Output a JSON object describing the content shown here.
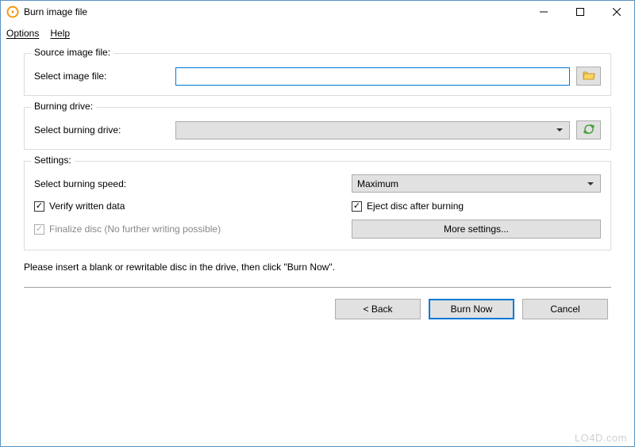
{
  "window": {
    "title": "Burn image file"
  },
  "menu": {
    "options": "Options",
    "help": "Help"
  },
  "group_source": {
    "legend": "Source image file:",
    "label": "Select image file:",
    "value": ""
  },
  "group_drive": {
    "legend": "Burning drive:",
    "label": "Select burning drive:",
    "selected": ""
  },
  "group_settings": {
    "legend": "Settings:",
    "speed_label": "Select burning speed:",
    "speed_value": "Maximum",
    "verify_label": "Verify written data",
    "verify_checked": true,
    "eject_label": "Eject disc after burning",
    "eject_checked": true,
    "finalize_label": "Finalize disc (No further writing possible)",
    "finalize_checked": true,
    "finalize_disabled": true,
    "more_label": "More settings..."
  },
  "instruction": "Please insert a blank or rewritable disc in the drive, then click \"Burn Now\".",
  "buttons": {
    "back": "< Back",
    "burn": "Burn Now",
    "cancel": "Cancel"
  },
  "watermark": "LO4D.com",
  "icons": {
    "folder": "folder-icon",
    "refresh": "refresh-icon",
    "app": "disc-icon"
  }
}
